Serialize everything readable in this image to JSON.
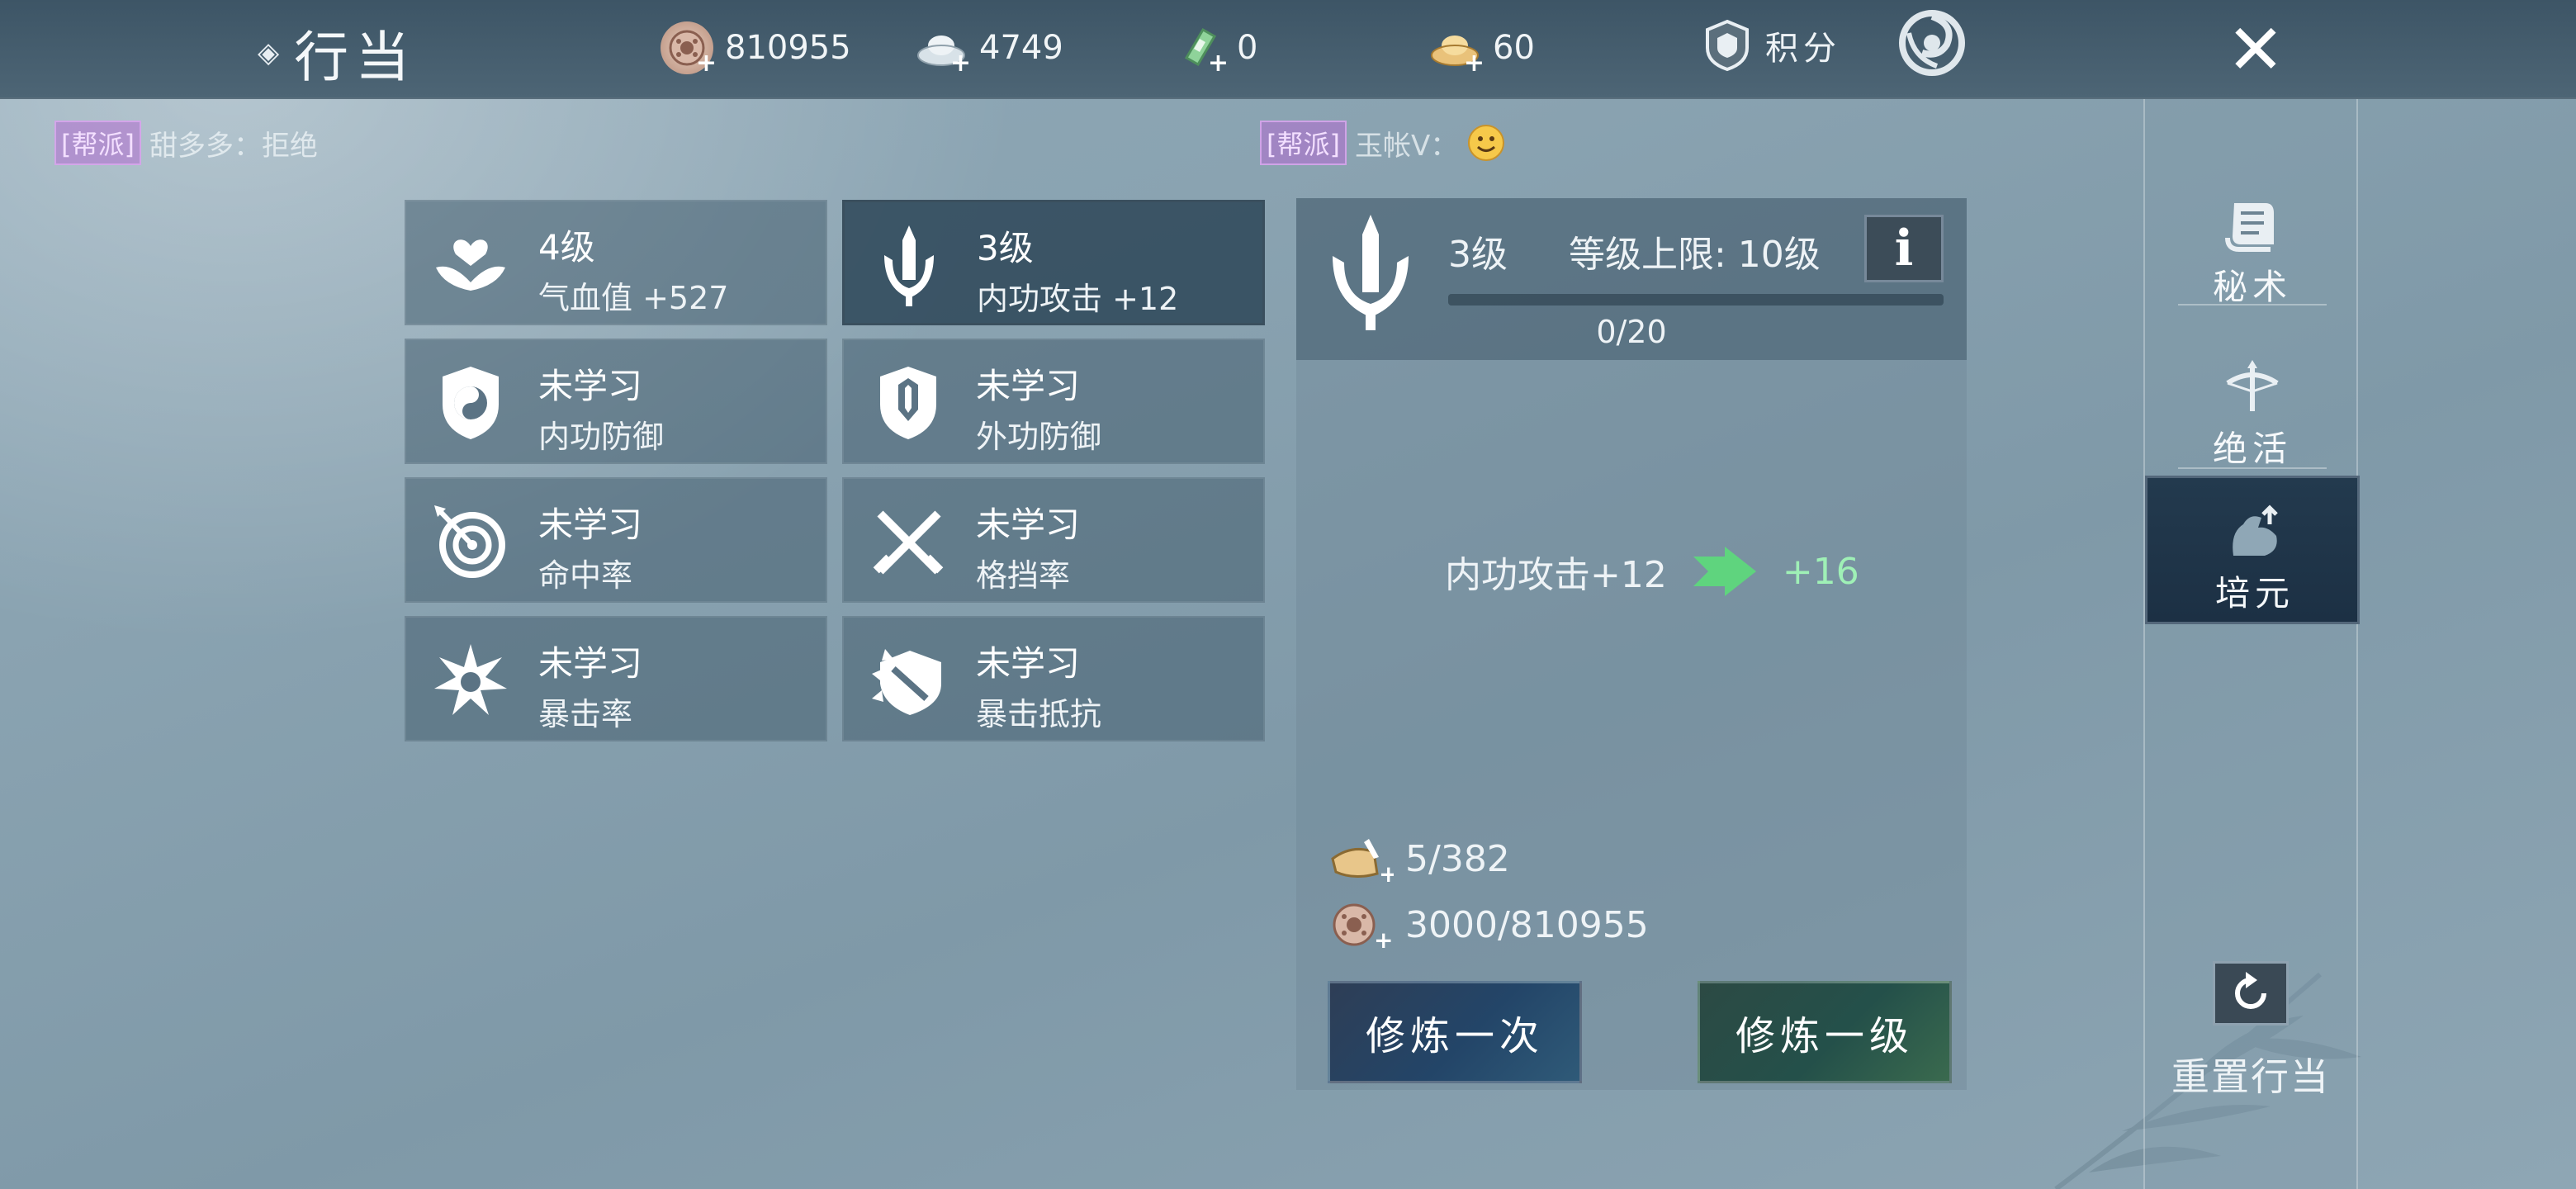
{
  "header": {
    "title": "行当",
    "currencies": [
      {
        "name": "coin-icon",
        "value": "810955"
      },
      {
        "name": "silver-ingot-icon",
        "value": "4749"
      },
      {
        "name": "jade-token-icon",
        "value": "0"
      },
      {
        "name": "gold-ingot-icon",
        "value": "60"
      }
    ],
    "score_label": "积分"
  },
  "chat": [
    {
      "tag": "[帮派]",
      "text": "甜多多：拒绝"
    },
    {
      "tag": "[帮派]",
      "text": "玉帐ᐯ："
    }
  ],
  "skills": [
    {
      "icon": "lotus-heart-icon",
      "level": "4级",
      "attr": "气血值  +527",
      "active": false
    },
    {
      "icon": "sword-emblem-icon",
      "level": "3级",
      "attr": "内功攻击  +12",
      "active": true
    },
    {
      "icon": "taiji-shield-icon",
      "level": "未学习",
      "attr": "内功防御",
      "active": false
    },
    {
      "icon": "crest-shield-icon",
      "level": "未学习",
      "attr": "外功防御",
      "active": false
    },
    {
      "icon": "target-arrow-icon",
      "level": "未学习",
      "attr": "命中率",
      "active": false
    },
    {
      "icon": "crossed-swords-icon",
      "level": "未学习",
      "attr": "格挡率",
      "active": false
    },
    {
      "icon": "burst-star-icon",
      "level": "未学习",
      "attr": "暴击率",
      "active": false
    },
    {
      "icon": "spiked-shield-icon",
      "level": "未学习",
      "attr": "暴击抵抗",
      "active": false
    }
  ],
  "detail": {
    "level": "3级",
    "cap": "等级上限: 10级",
    "info": "i",
    "progress_text": "0/20",
    "progress_fraction": 0,
    "effect_current": "内功攻击+12",
    "effect_next": "+16",
    "cost_material": "5/382",
    "cost_coin": "3000/810955",
    "btn_once": "修炼一次",
    "btn_level": "修炼一级"
  },
  "sidebar": {
    "items": [
      {
        "label": "秘术",
        "icon": "scroll-icon"
      },
      {
        "label": "绝活",
        "icon": "crossbow-icon"
      },
      {
        "label": "培元",
        "icon": "flex-arm-icon"
      }
    ],
    "reset_label": "重置行当"
  },
  "colors": {
    "topbar": "#3d5566",
    "tag": "#b46ed2",
    "next_value": "#9ff0b6",
    "active_tab": "#233a4e"
  }
}
